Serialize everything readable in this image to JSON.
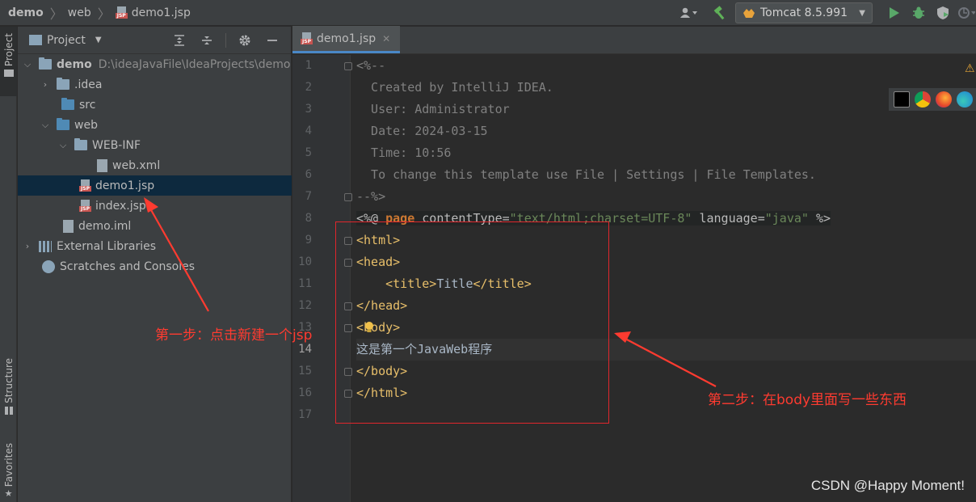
{
  "breadcrumb": {
    "project": "demo",
    "folder": "web",
    "file": "demo1.jsp"
  },
  "run_config": {
    "label": "Tomcat 8.5.991"
  },
  "left_stripe": {
    "project_tab": "Project",
    "structure_tab": "Structure",
    "favorites_tab": "Favorites"
  },
  "project_panel": {
    "title": "Project",
    "tree": [
      {
        "label": "demo",
        "path": "D:\\ideaJavaFile\\IdeaProjects\\demo"
      },
      {
        "label": ".idea"
      },
      {
        "label": "src"
      },
      {
        "label": "web"
      },
      {
        "label": "WEB-INF"
      },
      {
        "label": "web.xml"
      },
      {
        "label": "demo1.jsp"
      },
      {
        "label": "index.jsp"
      },
      {
        "label": "demo.iml"
      },
      {
        "label": "External Libraries"
      },
      {
        "label": "Scratches and Consoles"
      }
    ]
  },
  "editor": {
    "tab_label": "demo1.jsp",
    "line_numbers": [
      "1",
      "2",
      "3",
      "4",
      "5",
      "6",
      "7",
      "8",
      "9",
      "10",
      "11",
      "12",
      "13",
      "14",
      "15",
      "16",
      "17"
    ],
    "lines": {
      "l1": "<%--",
      "l2": "  Created by IntelliJ IDEA.",
      "l3": "  User: Administrator",
      "l4": "  Date: 2024-03-15",
      "l5": "  Time: 10:56",
      "l6": "  To change this template use File | Settings | File Templates.",
      "l7": "--%>",
      "l8_a": "<%@ ",
      "l8_b": "page",
      "l8_c": " contentType=",
      "l8_d": "\"text/html;charset=UTF-8\"",
      "l8_e": " language=",
      "l8_f": "\"java\"",
      "l8_g": " %>",
      "l9": "<html>",
      "l10": "<head>",
      "l11_a": "    <title>",
      "l11_b": "Title",
      "l11_c": "</title>",
      "l12": "</head>",
      "l13": "<body>",
      "l14": "这是第一个JavaWeb程序",
      "l15": "</body>",
      "l16": "</html>"
    }
  },
  "annotations": {
    "step1": "第一步：点击新建一个jsp",
    "step2": "第二步：在body里面写一些东西"
  },
  "watermark": "CSDN @Happy Moment!"
}
